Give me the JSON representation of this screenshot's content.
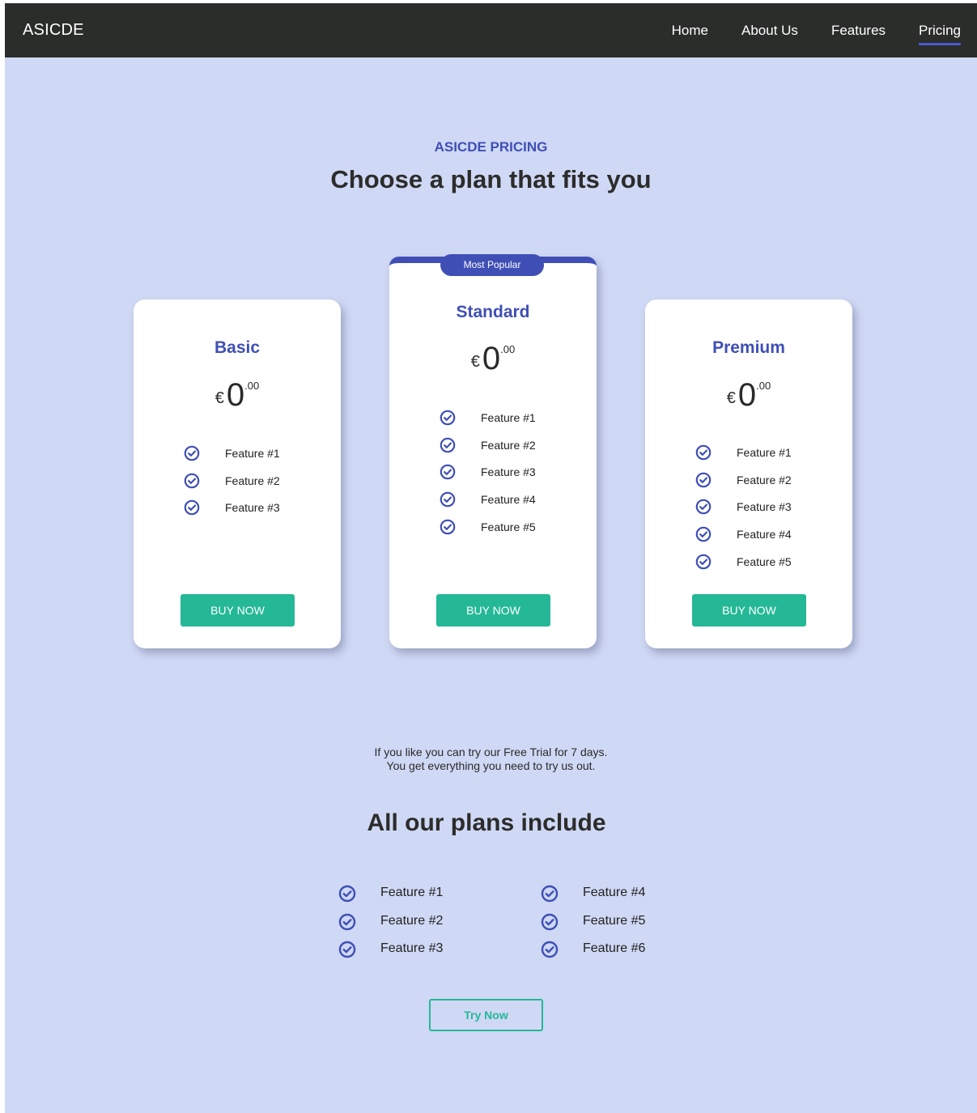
{
  "navbar": {
    "brand": "ASICDE",
    "links": [
      "Home",
      "About Us",
      "Features",
      "Pricing"
    ],
    "active": "Pricing"
  },
  "hero": {
    "eyebrow": "ASICDE PRICING",
    "headline": "Choose a plan that fits you"
  },
  "plans": [
    {
      "name": "Basic",
      "currency": "€",
      "price": "0",
      "cents": ".00",
      "features": [
        "Feature #1",
        "Feature #2",
        "Feature #3"
      ],
      "button": "BUY NOW"
    },
    {
      "name": "Standard",
      "badge": "Most Popular",
      "currency": "€",
      "price": "0",
      "cents": ".00",
      "features": [
        "Feature #1",
        "Feature #2",
        "Feature #3",
        "Feature #4",
        "Feature #5"
      ],
      "button": "BUY NOW"
    },
    {
      "name": "Premium",
      "currency": "€",
      "price": "0",
      "cents": ".00",
      "features": [
        "Feature #1",
        "Feature #2",
        "Feature #3",
        "Feature #4",
        "Feature #5"
      ],
      "button": "BUY NOW"
    }
  ],
  "trial": {
    "line1": "If you like you can try our Free Trial for 7 days.",
    "line2": "You get everything you need to try us out."
  },
  "includes": {
    "title": "All our plans include",
    "left": [
      "Feature #1",
      "Feature #2",
      "Feature #3"
    ],
    "right": [
      "Feature #4",
      "Feature #5",
      "Feature #6"
    ],
    "button": "Try Now"
  },
  "colors": {
    "background": "#cfd8f4",
    "navbar": "#2b2d2b",
    "accent": "#3f4fb5",
    "button": "#25b897"
  },
  "icons": {
    "feature": "check-circle-icon"
  }
}
